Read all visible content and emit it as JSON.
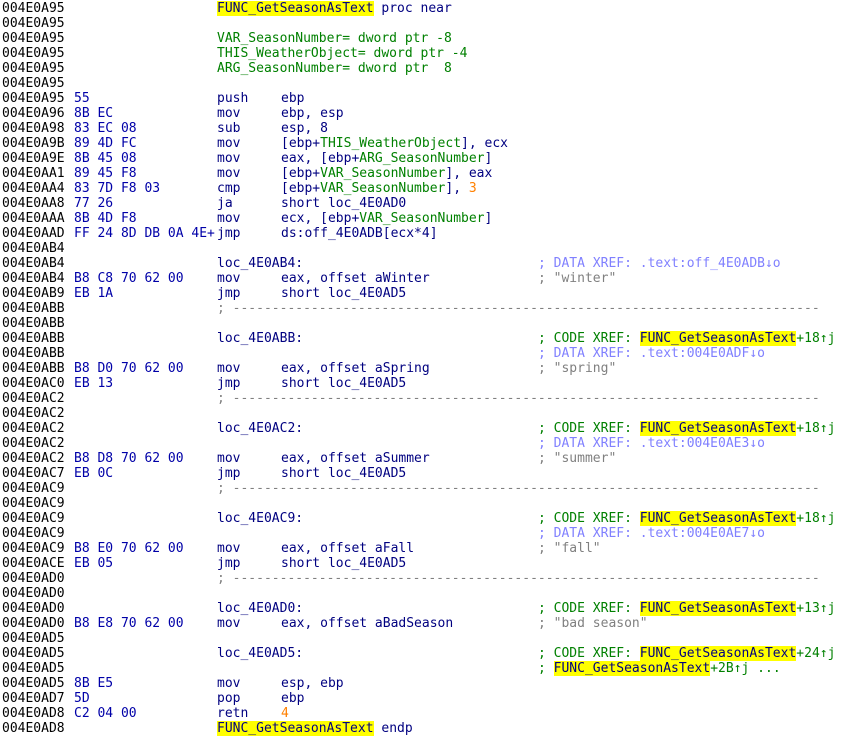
{
  "lines": [
    {
      "addr": "004E0A95",
      "kind": "proc_start",
      "name": "FUNC_GetSeasonAsText",
      "suffix": " proc near"
    },
    {
      "addr": "004E0A95",
      "kind": "blank"
    },
    {
      "addr": "004E0A95",
      "kind": "var",
      "text": "VAR_SeasonNumber= dword ptr -8"
    },
    {
      "addr": "004E0A95",
      "kind": "var",
      "text": "THIS_WeatherObject= dword ptr -4"
    },
    {
      "addr": "004E0A95",
      "kind": "var",
      "text": "ARG_SeasonNumber= dword ptr  8"
    },
    {
      "addr": "004E0A95",
      "kind": "blank"
    },
    {
      "addr": "004E0A95",
      "kind": "instr",
      "bytes": "55",
      "mnemonic": "push",
      "operands": [
        {
          "t": "ebp",
          "c": "navy"
        }
      ]
    },
    {
      "addr": "004E0A96",
      "kind": "instr",
      "bytes": "8B EC",
      "mnemonic": "mov",
      "operands": [
        {
          "t": "ebp, esp",
          "c": "navy"
        }
      ]
    },
    {
      "addr": "004E0A98",
      "kind": "instr",
      "bytes": "83 EC 08",
      "mnemonic": "sub",
      "operands": [
        {
          "t": "esp, ",
          "c": "navy"
        },
        {
          "t": "8",
          "c": "navy"
        }
      ]
    },
    {
      "addr": "004E0A9B",
      "kind": "instr",
      "bytes": "89 4D FC",
      "mnemonic": "mov",
      "operands": [
        {
          "t": "[ebp+",
          "c": "navy"
        },
        {
          "t": "THIS_WeatherObject",
          "c": "green"
        },
        {
          "t": "], ecx",
          "c": "navy"
        }
      ]
    },
    {
      "addr": "004E0A9E",
      "kind": "instr",
      "bytes": "8B 45 08",
      "mnemonic": "mov",
      "operands": [
        {
          "t": "eax, [ebp+",
          "c": "navy"
        },
        {
          "t": "ARG_SeasonNumber",
          "c": "green"
        },
        {
          "t": "]",
          "c": "navy"
        }
      ]
    },
    {
      "addr": "004E0AA1",
      "kind": "instr",
      "bytes": "89 45 F8",
      "mnemonic": "mov",
      "operands": [
        {
          "t": "[ebp+",
          "c": "navy"
        },
        {
          "t": "VAR_SeasonNumber",
          "c": "green"
        },
        {
          "t": "], eax",
          "c": "navy"
        }
      ]
    },
    {
      "addr": "004E0AA4",
      "kind": "instr",
      "bytes": "83 7D F8 03",
      "mnemonic": "cmp",
      "operands": [
        {
          "t": "[ebp+",
          "c": "navy"
        },
        {
          "t": "VAR_SeasonNumber",
          "c": "green"
        },
        {
          "t": "], ",
          "c": "navy"
        },
        {
          "t": "3",
          "c": "num"
        }
      ]
    },
    {
      "addr": "004E0AA8",
      "kind": "instr",
      "bytes": "77 26",
      "mnemonic": "ja",
      "operands": [
        {
          "t": "short loc_4E0AD0",
          "c": "navy"
        }
      ]
    },
    {
      "addr": "004E0AAA",
      "kind": "instr",
      "bytes": "8B 4D F8",
      "mnemonic": "mov",
      "operands": [
        {
          "t": "ecx, [ebp+",
          "c": "navy"
        },
        {
          "t": "VAR_SeasonNumber",
          "c": "green"
        },
        {
          "t": "]",
          "c": "navy"
        }
      ]
    },
    {
      "addr": "004E0AAD",
      "kind": "instr",
      "bytes": "FF 24 8D DB 0A 4E+",
      "mnemonic": "jmp",
      "mnemonic_left_tight": true,
      "operands": [
        {
          "t": "ds:off_4E0ADB[ecx*4]",
          "c": "navy"
        }
      ]
    },
    {
      "addr": "004E0AB4",
      "kind": "blank"
    },
    {
      "addr": "004E0AB4",
      "kind": "label",
      "label": "loc_4E0AB4:",
      "comment": [
        {
          "t": "; DATA XREF: .text:off_4E0ADB↓o",
          "c": "drefc"
        }
      ]
    },
    {
      "addr": "004E0AB4",
      "kind": "instr",
      "bytes": "B8 C8 70 62 00",
      "mnemonic": "mov",
      "operands": [
        {
          "t": "eax, offset aWinter",
          "c": "navy"
        }
      ],
      "comment": [
        {
          "t": "; \"winter\"",
          "c": "strc"
        }
      ]
    },
    {
      "addr": "004E0AB9",
      "kind": "instr",
      "bytes": "EB 1A",
      "mnemonic": "jmp",
      "operands": [
        {
          "t": "short loc_4E0AD5",
          "c": "navy"
        }
      ]
    },
    {
      "addr": "004E0ABB",
      "kind": "sep",
      "text": "; ---------------------------------------------------------------------------"
    },
    {
      "addr": "004E0ABB",
      "kind": "blank"
    },
    {
      "addr": "004E0ABB",
      "kind": "label",
      "label": "loc_4E0ABB:",
      "comment": [
        {
          "t": "; CODE XREF: ",
          "c": "xrefc"
        },
        {
          "t": "FUNC_GetSeasonAsText",
          "c": "fn"
        },
        {
          "t": "+18↑j",
          "c": "xrefc"
        }
      ]
    },
    {
      "addr": "004E0ABB",
      "kind": "comment_only",
      "comment": [
        {
          "t": "; DATA XREF: .text:004E0ADF↓o",
          "c": "drefc"
        }
      ]
    },
    {
      "addr": "004E0ABB",
      "kind": "instr",
      "bytes": "B8 D0 70 62 00",
      "mnemonic": "mov",
      "operands": [
        {
          "t": "eax, offset aSpring",
          "c": "navy"
        }
      ],
      "comment": [
        {
          "t": "; \"spring\"",
          "c": "strc"
        }
      ]
    },
    {
      "addr": "004E0AC0",
      "kind": "instr",
      "bytes": "EB 13",
      "mnemonic": "jmp",
      "operands": [
        {
          "t": "short loc_4E0AD5",
          "c": "navy"
        }
      ]
    },
    {
      "addr": "004E0AC2",
      "kind": "sep",
      "text": "; ---------------------------------------------------------------------------"
    },
    {
      "addr": "004E0AC2",
      "kind": "blank"
    },
    {
      "addr": "004E0AC2",
      "kind": "label",
      "label": "loc_4E0AC2:",
      "comment": [
        {
          "t": "; CODE XREF: ",
          "c": "xrefc"
        },
        {
          "t": "FUNC_GetSeasonAsText",
          "c": "fn"
        },
        {
          "t": "+18↑j",
          "c": "xrefc"
        }
      ]
    },
    {
      "addr": "004E0AC2",
      "kind": "comment_only",
      "comment": [
        {
          "t": "; DATA XREF: .text:004E0AE3↓o",
          "c": "drefc"
        }
      ]
    },
    {
      "addr": "004E0AC2",
      "kind": "instr",
      "bytes": "B8 D8 70 62 00",
      "mnemonic": "mov",
      "operands": [
        {
          "t": "eax, offset aSummer",
          "c": "navy"
        }
      ],
      "comment": [
        {
          "t": "; \"summer\"",
          "c": "strc"
        }
      ]
    },
    {
      "addr": "004E0AC7",
      "kind": "instr",
      "bytes": "EB 0C",
      "mnemonic": "jmp",
      "operands": [
        {
          "t": "short loc_4E0AD5",
          "c": "navy"
        }
      ]
    },
    {
      "addr": "004E0AC9",
      "kind": "sep",
      "text": "; ---------------------------------------------------------------------------"
    },
    {
      "addr": "004E0AC9",
      "kind": "blank"
    },
    {
      "addr": "004E0AC9",
      "kind": "label",
      "label": "loc_4E0AC9:",
      "comment": [
        {
          "t": "; CODE XREF: ",
          "c": "xrefc"
        },
        {
          "t": "FUNC_GetSeasonAsText",
          "c": "fn"
        },
        {
          "t": "+18↑j",
          "c": "xrefc"
        }
      ]
    },
    {
      "addr": "004E0AC9",
      "kind": "comment_only",
      "comment": [
        {
          "t": "; DATA XREF: .text:004E0AE7↓o",
          "c": "drefc"
        }
      ]
    },
    {
      "addr": "004E0AC9",
      "kind": "instr",
      "bytes": "B8 E0 70 62 00",
      "mnemonic": "mov",
      "operands": [
        {
          "t": "eax, offset aFall",
          "c": "navy"
        }
      ],
      "comment": [
        {
          "t": "; \"fall\"",
          "c": "strc"
        }
      ]
    },
    {
      "addr": "004E0ACE",
      "kind": "instr",
      "bytes": "EB 05",
      "mnemonic": "jmp",
      "operands": [
        {
          "t": "short loc_4E0AD5",
          "c": "navy"
        }
      ]
    },
    {
      "addr": "004E0AD0",
      "kind": "sep",
      "text": "; ---------------------------------------------------------------------------"
    },
    {
      "addr": "004E0AD0",
      "kind": "blank"
    },
    {
      "addr": "004E0AD0",
      "kind": "label",
      "label": "loc_4E0AD0:",
      "comment": [
        {
          "t": "; CODE XREF: ",
          "c": "xrefc"
        },
        {
          "t": "FUNC_GetSeasonAsText",
          "c": "fn"
        },
        {
          "t": "+13↑j",
          "c": "xrefc"
        }
      ]
    },
    {
      "addr": "004E0AD0",
      "kind": "instr",
      "bytes": "B8 E8 70 62 00",
      "mnemonic": "mov",
      "operands": [
        {
          "t": "eax, offset aBadSeason",
          "c": "navy"
        }
      ],
      "comment": [
        {
          "t": "; \"bad season\"",
          "c": "strc"
        }
      ]
    },
    {
      "addr": "004E0AD5",
      "kind": "blank"
    },
    {
      "addr": "004E0AD5",
      "kind": "label",
      "label": "loc_4E0AD5:",
      "comment": [
        {
          "t": "; CODE XREF: ",
          "c": "xrefc"
        },
        {
          "t": "FUNC_GetSeasonAsText",
          "c": "fn"
        },
        {
          "t": "+24↑j",
          "c": "xrefc"
        }
      ]
    },
    {
      "addr": "004E0AD5",
      "kind": "comment_only",
      "comment": [
        {
          "t": "; ",
          "c": "xrefc"
        },
        {
          "t": "FUNC_GetSeasonAsText",
          "c": "fn"
        },
        {
          "t": "+2B↑j ...",
          "c": "xrefc"
        }
      ]
    },
    {
      "addr": "004E0AD5",
      "kind": "instr",
      "bytes": "8B E5",
      "mnemonic": "mov",
      "operands": [
        {
          "t": "esp, ebp",
          "c": "navy"
        }
      ]
    },
    {
      "addr": "004E0AD7",
      "kind": "instr",
      "bytes": "5D",
      "mnemonic": "pop",
      "operands": [
        {
          "t": "ebp",
          "c": "navy"
        }
      ]
    },
    {
      "addr": "004E0AD8",
      "kind": "instr",
      "bytes": "C2 04 00",
      "mnemonic": "retn",
      "operands": [
        {
          "t": "4",
          "c": "num"
        }
      ]
    },
    {
      "addr": "004E0AD8",
      "kind": "proc_end",
      "name": "FUNC_GetSeasonAsText",
      "suffix": " endp"
    }
  ]
}
